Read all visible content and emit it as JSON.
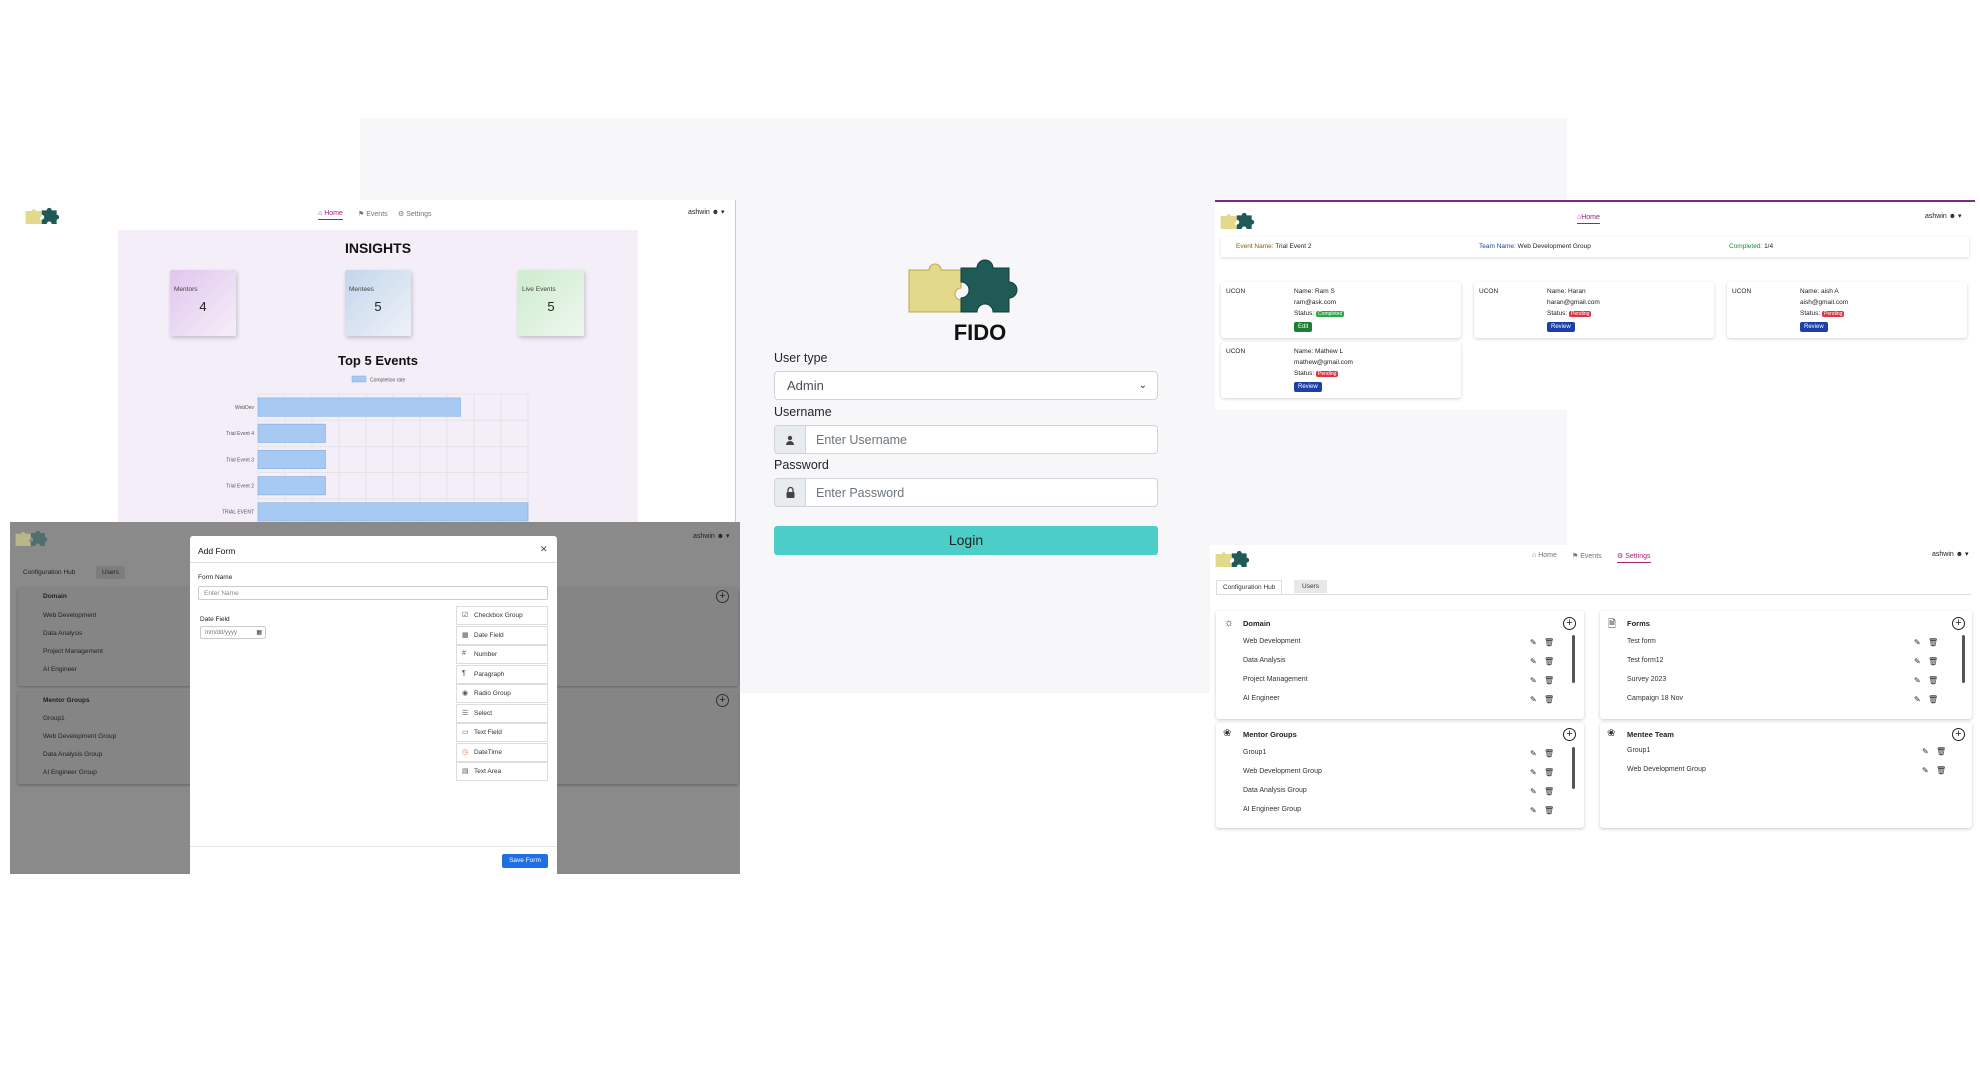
{
  "app": {
    "name": "FIDO",
    "user": "ashwin"
  },
  "nav": {
    "home": "Home",
    "events": "Events",
    "settings": "Settings"
  },
  "login": {
    "title": "FIDO",
    "user_type_label": "User type",
    "user_type_value": "Admin",
    "username_label": "Username",
    "username_placeholder": "Enter Username",
    "password_label": "Password",
    "password_placeholder": "Enter Password",
    "login_button": "Login",
    "colors": {
      "button": "#4ccdc7"
    }
  },
  "insights": {
    "title": "INSIGHTS",
    "cards": [
      {
        "label": "Mentors",
        "value": "4",
        "color": "#e2c8ee"
      },
      {
        "label": "Mentees",
        "value": "5",
        "color": "#c6d8ec"
      },
      {
        "label": "Live Events",
        "value": "5",
        "color": "#cfeed0"
      }
    ],
    "chart_title": "Top 5 Events"
  },
  "chart_data": {
    "type": "bar",
    "orientation": "horizontal",
    "title": "Top 5 Events",
    "legend": [
      "Completion rate"
    ],
    "categories": [
      "WebDev",
      "Trial Event 4",
      "Trial Event 3",
      "Trial Event 2",
      "TRIAL EVENT"
    ],
    "series": [
      {
        "name": "Completion rate",
        "values": [
          0.75,
          0.25,
          0.25,
          0.25,
          1.0
        ]
      }
    ],
    "xlim": [
      0,
      1
    ],
    "grid": true,
    "colors": {
      "bar": "#a7c9f2",
      "bar_border": "#7eaee6"
    }
  },
  "config": {
    "tabs": [
      "Configuration Hub",
      "Users"
    ],
    "domain": {
      "title": "Domain",
      "items": [
        "Web Development",
        "Data Analysis",
        "Project Management",
        "AI Engineer"
      ]
    },
    "mentor_groups": {
      "title": "Mentor Groups",
      "items": [
        "Group1",
        "Web Development Group",
        "Data Analysis Group",
        "AI Engineer Group"
      ]
    },
    "forms": {
      "title": "Forms",
      "items": [
        "Test form",
        "Test form12",
        "Survey 2023",
        "Campaign 18 Nov"
      ]
    },
    "mentee_team": {
      "title": "Mentee Team",
      "items": [
        "Group1",
        "Web Development Group"
      ]
    }
  },
  "add_form": {
    "title": "Add Form",
    "form_name_label": "Form Name",
    "form_name_placeholder": "Enter Name",
    "date_field_label": "Date Field",
    "date_placeholder": "mm/dd/yyyy",
    "palette": [
      {
        "icon": "checkbox-group-icon",
        "label": "Checkbox Group"
      },
      {
        "icon": "date-field-icon",
        "label": "Date Field"
      },
      {
        "icon": "number-icon",
        "label": "Number"
      },
      {
        "icon": "paragraph-icon",
        "label": "Paragraph"
      },
      {
        "icon": "radio-group-icon",
        "label": "Radio Group"
      },
      {
        "icon": "select-icon",
        "label": "Select"
      },
      {
        "icon": "text-field-icon",
        "label": "Text Field"
      },
      {
        "icon": "datetime-icon",
        "label": "DateTime"
      },
      {
        "icon": "text-area-icon",
        "label": "Text Area"
      }
    ],
    "save_button": "Save Form",
    "colors": {
      "save_button": "#1f6fe0"
    }
  },
  "event_detail": {
    "event_name_label": "Event Name:",
    "event_name": "Trial Event 2",
    "team_name_label": "Team Name:",
    "team_name": "Web Development Group",
    "completed_label": "Completed:",
    "completed": "1/4",
    "mentees": [
      {
        "org": "UCON",
        "name": "Name: Ram S",
        "email": "ram@ask.com",
        "status_label": "Status:",
        "status": "Completed",
        "status_color": "#28a745",
        "action": "Edit",
        "action_color": "#1e7e34"
      },
      {
        "org": "UCON",
        "name": "Name: Haran",
        "email": "haran@gmail.com",
        "status_label": "Status:",
        "status": "Pending",
        "status_color": "#dc3545",
        "action": "Review",
        "action_color": "#1c3fa8"
      },
      {
        "org": "UCON",
        "name": "Name: aish A",
        "email": "aish@gmail.com",
        "status_label": "Status:",
        "status": "Pending",
        "status_color": "#dc3545",
        "action": "Review",
        "action_color": "#1c3fa8"
      },
      {
        "org": "UCON",
        "name": "Name: Mathew L",
        "email": "mathew@gmail.com",
        "status_label": "Status:",
        "status": "Pending",
        "status_color": "#dc3545",
        "action": "Review",
        "action_color": "#1c3fa8"
      }
    ]
  }
}
